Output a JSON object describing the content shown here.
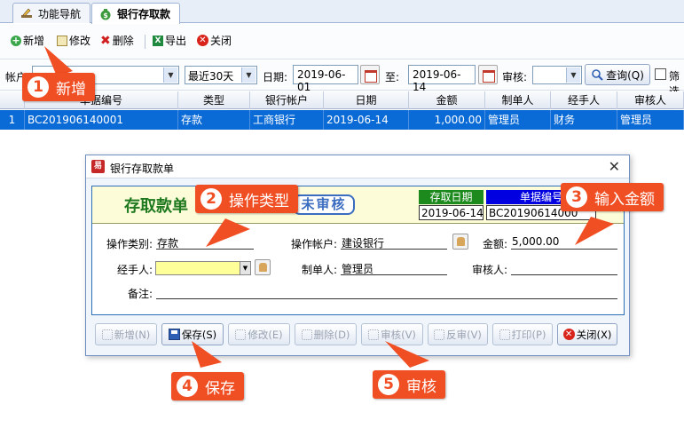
{
  "tabs": [
    {
      "label": "功能导航",
      "icon": "pencil-icon"
    },
    {
      "label": "银行存取款",
      "icon": "money-bag-icon"
    }
  ],
  "toolbar": {
    "add": "新增",
    "edit": "修改",
    "delete": "删除",
    "export": "导出",
    "close": "关闭"
  },
  "filters": {
    "account_label": "帐户",
    "account_value": "",
    "period_value": "最近30天",
    "date_label": "日期:",
    "date_from": "2019-06-01",
    "to_label": "至:",
    "date_to": "2019-06-14",
    "audit_label": "审核:",
    "audit_value": "",
    "query_label": "查询(Q)",
    "filter_label": "筛选"
  },
  "grid": {
    "columns": [
      "",
      "单据编号",
      "类型",
      "银行帐户",
      "日期",
      "金额",
      "制单人",
      "经手人",
      "审核人"
    ],
    "rows": [
      {
        "no": "1",
        "bill_no": "BC201906140001",
        "type": "存款",
        "account": "工商银行",
        "date": "2019-06-14",
        "amount": "1,000.00",
        "maker": "管理员",
        "handler": "财务",
        "auditor": "管理员"
      }
    ]
  },
  "dialog": {
    "title": "银行存取款单",
    "close_glyph": "✕",
    "form_title": "存取款单",
    "status": "未审核",
    "date_header": "存取日期",
    "date_value": "2019-06-14",
    "billno_header": "单据编号",
    "billno_value": "BC20190614000",
    "op_type_label": "操作类别:",
    "op_type_value": "存款",
    "op_account_label": "操作帐户:",
    "op_account_value": "建设银行",
    "amount_label": "金额:",
    "amount_value": "5,000.00",
    "handler_label": "经手人:",
    "handler_value": "",
    "maker_label": "制单人:",
    "maker_value": "管理员",
    "auditor_label": "审核人:",
    "auditor_value": "",
    "remark_label": "备注:",
    "remark_value": "",
    "buttons": {
      "add": "新增(N)",
      "save": "保存(S)",
      "edit": "修改(E)",
      "delete": "删除(D)",
      "audit": "审核(V)",
      "unaudit": "反审(V)",
      "print": "打印(P)",
      "close": "关闭(X)"
    }
  },
  "callouts": [
    {
      "num": "1",
      "text": "新增"
    },
    {
      "num": "2",
      "text": "操作类型"
    },
    {
      "num": "3",
      "text": "输入金额"
    },
    {
      "num": "4",
      "text": "保存"
    },
    {
      "num": "5",
      "text": "审核"
    }
  ],
  "colors": {
    "callout": "#f04e23",
    "selected_row": "#0a6ad6",
    "form_title": "#1f7a1f",
    "status_blue": "#3a6cc0",
    "date_header_bg": "#1d8a1d",
    "billno_header_bg": "#0000e0"
  }
}
